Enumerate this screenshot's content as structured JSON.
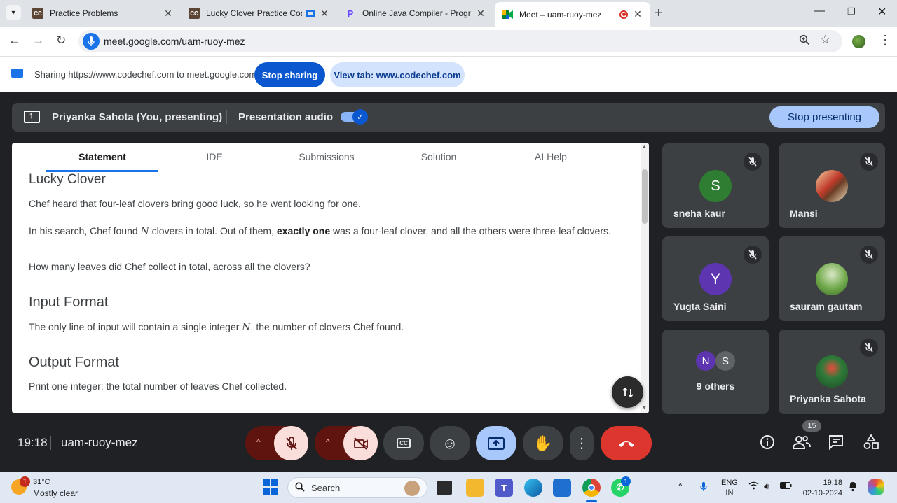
{
  "browser": {
    "tabs": [
      {
        "title": "Practice Problems",
        "favicon": "codechef-icon"
      },
      {
        "title": "Lucky Clover Practice Codin",
        "favicon": "codechef-icon"
      },
      {
        "title": "Online Java Compiler - Program",
        "favicon": "programiz-icon"
      },
      {
        "title": "Meet – uam-ruoy-mez",
        "favicon": "meet-icon",
        "active": true
      }
    ],
    "url": "meet.google.com/uam-ruoy-mez"
  },
  "sharebar": {
    "text": "Sharing https://www.codechef.com to meet.google.com",
    "stop_label": "Stop sharing",
    "view_label": "View tab: www.codechef.com"
  },
  "presenting": {
    "name": "Priyanka Sahota (You, presenting)",
    "audio_label": "Presentation audio",
    "audio_on": true,
    "stop_label": "Stop presenting"
  },
  "content": {
    "tabs": [
      "Statement",
      "IDE",
      "Submissions",
      "Solution",
      "AI Help"
    ],
    "active_tab": "Statement",
    "title": "Lucky Clover",
    "para1": "Chef heard that four-leaf clovers bring good luck, so he went looking for one.",
    "para2a": "In his search, Chef found ",
    "var_n": "N",
    "para2b": " clovers in total. Out of them, ",
    "para2_bold": "exactly one",
    "para2c": " was a four-leaf clover, and all the others were three-leaf clovers.",
    "para3": "How many leaves did Chef collect in total, across all the clovers?",
    "input_heading": "Input Format",
    "input_text_a": "The only line of input will contain a single integer ",
    "input_text_b": ", the number of clovers Chef found.",
    "output_heading": "Output Format",
    "output_text": "Print one integer: the total number of leaves Chef collected."
  },
  "participants": [
    {
      "name": "sneha kaur",
      "initial": "S",
      "color": "#2e7d32"
    },
    {
      "name": "Mansi",
      "initial": "",
      "color": "#c0392b"
    },
    {
      "name": "Yugta Saini",
      "initial": "Y",
      "color": "#5e35b1"
    },
    {
      "name": "sauram gautam",
      "initial": "",
      "color": "#4a8a3a"
    },
    {
      "name": "9 others",
      "initials": [
        "N",
        "S"
      ]
    },
    {
      "name": "Priyanka Sahota",
      "initial": "",
      "color": "#2f7a3a"
    }
  ],
  "meeting": {
    "time": "19:18",
    "code": "uam-ruoy-mez",
    "people_count": "15"
  },
  "taskbar": {
    "temp": "31°C",
    "weather": "Mostly clear",
    "weather_badge": "1",
    "search_placeholder": "Search",
    "lang_top": "ENG",
    "lang_bottom": "IN",
    "clock_time": "19:18",
    "clock_date": "02-10-2024",
    "whatsapp_badge": "1"
  }
}
